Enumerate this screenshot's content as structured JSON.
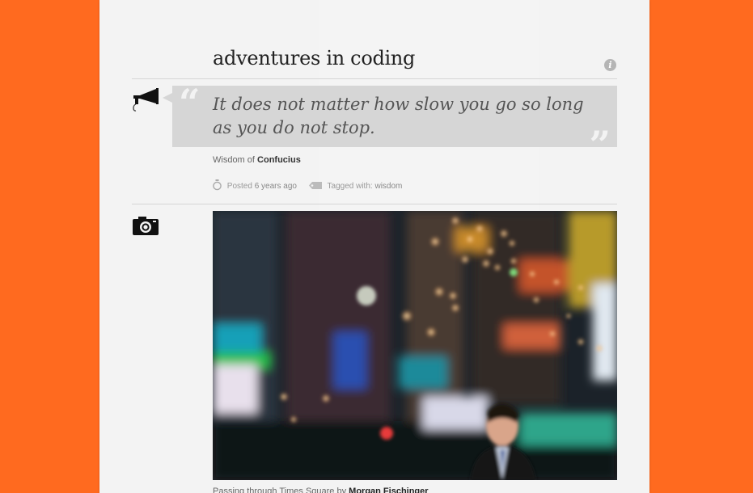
{
  "blog": {
    "title": "adventures in coding",
    "info_icon": "info-icon"
  },
  "quote_post": {
    "icon": "megaphone-icon",
    "open_mark": "“",
    "close_mark": "”",
    "text": "It does not matter how slow you go so long as you do not stop.",
    "source_prefix": "Wisdom of",
    "source_name": "Confucius",
    "posted_label": "Posted",
    "posted_time": "6 years ago",
    "tagged_label": "Tagged with:",
    "tag": "wisdom"
  },
  "photo_post": {
    "icon": "camera-icon",
    "caption_prefix": "Passing through Times Square by",
    "caption_author": "Morgan Fischinger"
  },
  "colors": {
    "background": "#ff6a1f",
    "page": "#f3f3f3",
    "quote_box": "#d6d6d6"
  }
}
